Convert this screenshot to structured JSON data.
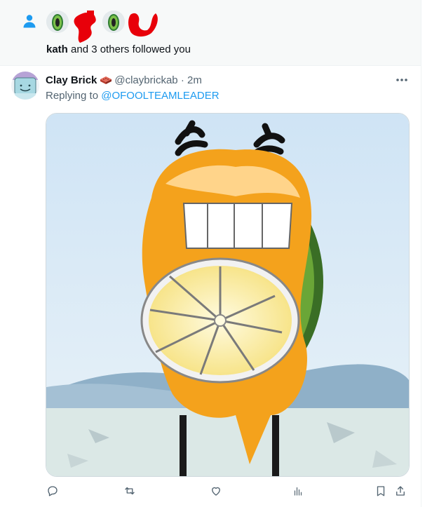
{
  "notification": {
    "icon": "person-icon",
    "actor_name": "kath",
    "suffix_text": " and 3 others followed you",
    "accent_color": "#1d9bf0"
  },
  "tweet": {
    "display_name": "Clay Brick",
    "name_emoji_icon": "brick-icon",
    "handle": "@claybrickab",
    "separator": "·",
    "timestamp": "2m",
    "replying_prefix": "Replying to ",
    "replying_to": "@OFOOLTEAMLEADER",
    "more_icon": "more-icon",
    "actions": [
      {
        "name": "reply-icon"
      },
      {
        "name": "retweet-icon"
      },
      {
        "name": "like-icon"
      },
      {
        "name": "views-icon"
      },
      {
        "name": "bookmark-icon"
      },
      {
        "name": "share-icon"
      }
    ]
  },
  "colors": {
    "link": "#1d9bf0",
    "secondary_text": "#536471",
    "primary_text": "#0f1419",
    "scribble": "#e8000a"
  }
}
